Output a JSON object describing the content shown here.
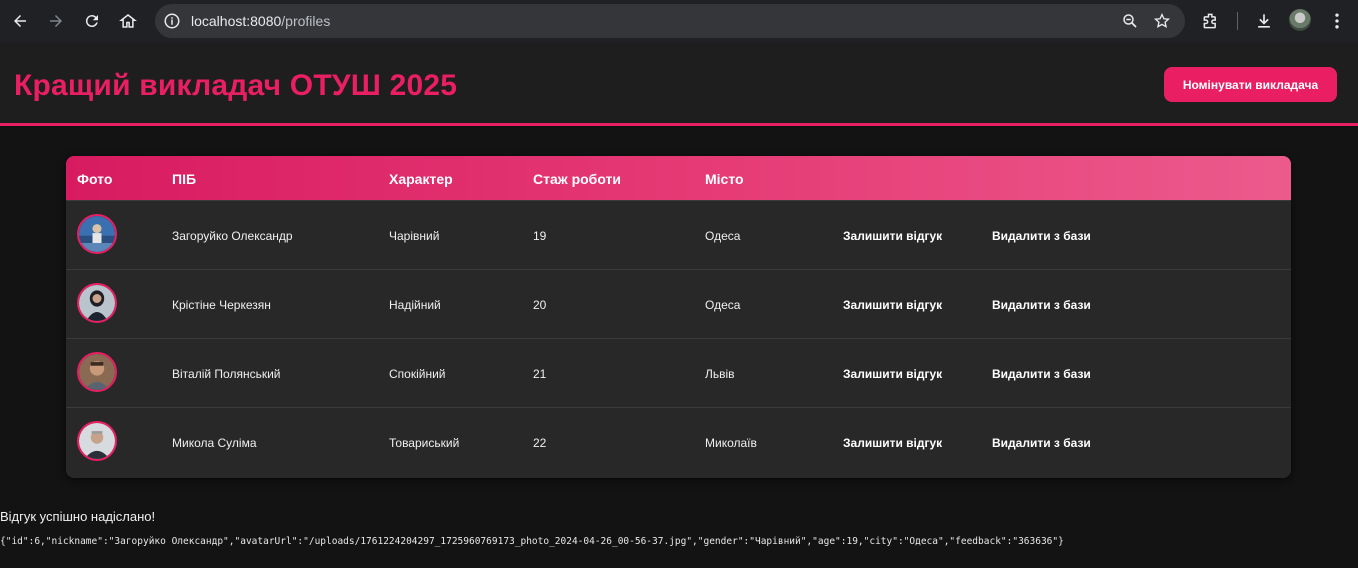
{
  "browser": {
    "url_host": "localhost:8080",
    "url_path": "/profiles"
  },
  "header": {
    "title": "Кращий викладач ОТУШ 2025",
    "nominate_label": "Номінувати викладача"
  },
  "table": {
    "columns": [
      "Фото",
      "ПІБ",
      "Характер",
      "Стаж роботи",
      "Місто"
    ],
    "rows": [
      {
        "name": "Загоруйко Олександр",
        "character": "Чарівний",
        "experience": "19",
        "city": "Одеса",
        "feedback_label": "Залишити відгук",
        "delete_label": "Видалити з бази"
      },
      {
        "name": "Крістіне Черкезян",
        "character": "Надійний",
        "experience": "20",
        "city": "Одеса",
        "feedback_label": "Залишити відгук",
        "delete_label": "Видалити з бази"
      },
      {
        "name": "Віталій Полянський",
        "character": "Спокійний",
        "experience": "21",
        "city": "Львів",
        "feedback_label": "Залишити відгук",
        "delete_label": "Видалити з бази"
      },
      {
        "name": "Микола Суліма",
        "character": "Товариський",
        "experience": "22",
        "city": "Миколаїв",
        "feedback_label": "Залишити відгук",
        "delete_label": "Видалити з бази"
      }
    ]
  },
  "status_message": "Відгук успішно надіслано!",
  "response_json": "{\"id\":6,\"nickname\":\"Загоруйко Олександр\",\"avatarUrl\":\"/uploads/1761224204297_1725960769173_photo_2024-04-26_00-56-37.jpg\",\"gender\":\"Чарівний\",\"age\":19,\"city\":\"Одеса\",\"feedback\":\"363636\"}",
  "colors": {
    "accent": "#e91e63",
    "background": "#131313",
    "table_bg": "#282828"
  },
  "icons": [
    "back-icon",
    "forward-icon",
    "reload-icon",
    "home-icon",
    "info-icon",
    "zoom-icon",
    "star-icon",
    "extensions-icon",
    "download-icon",
    "menu-icon"
  ]
}
